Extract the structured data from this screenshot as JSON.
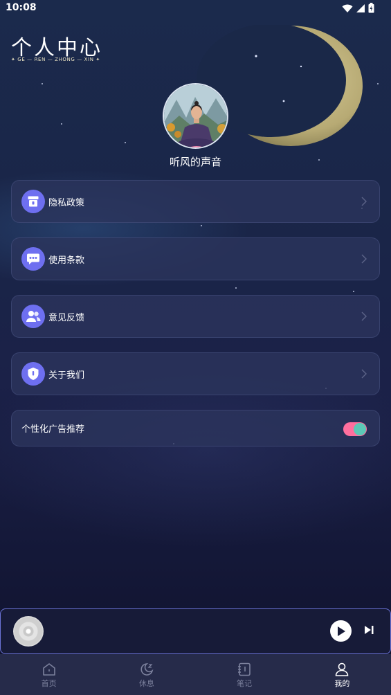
{
  "status_bar": {
    "time": "10:08"
  },
  "header": {
    "title": "个人中心",
    "subtitle": "✦ GE — REN — ZHONG — XIN ✦"
  },
  "profile": {
    "username": "听风的声音"
  },
  "menu": [
    {
      "label": "隐私政策",
      "icon": "privacy-icon"
    },
    {
      "label": "使用条款",
      "icon": "chat-icon"
    },
    {
      "label": "意见反馈",
      "icon": "users-icon"
    },
    {
      "label": "关于我们",
      "icon": "shield-icon"
    }
  ],
  "ad_setting": {
    "label": "个性化广告推荐",
    "enabled": true
  },
  "nav": [
    {
      "label": "首页",
      "icon": "home-icon",
      "active": false
    },
    {
      "label": "休息",
      "icon": "moon-icon",
      "active": false
    },
    {
      "label": "笔记",
      "icon": "notebook-icon",
      "active": false
    },
    {
      "label": "我的",
      "icon": "user-icon",
      "active": true
    }
  ],
  "colors": {
    "accent": "#6e6ff0",
    "toggle_track": "#ff6f9e",
    "toggle_knob": "#5cc8b6",
    "player_border": "#6c74d8"
  }
}
